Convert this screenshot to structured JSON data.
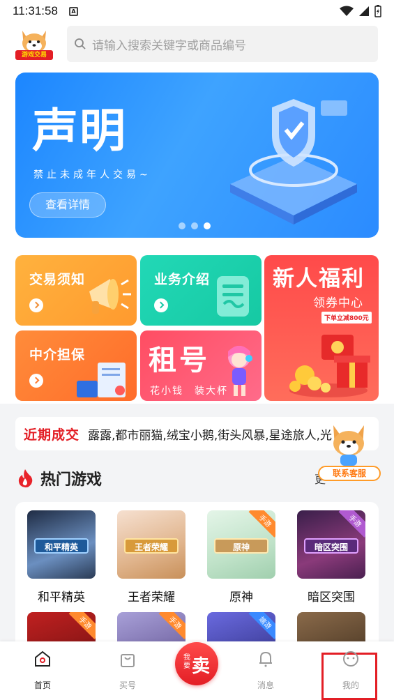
{
  "status_bar": {
    "time": "11:31:58"
  },
  "header": {
    "logo_text": "游戏交易",
    "search_placeholder": "请输入搜索关键字或商品编号"
  },
  "banner": {
    "title": "声明",
    "subtitle": "禁止未成年人交易~",
    "button": "查看详情",
    "dots": 3,
    "active_dot": 3
  },
  "cards": {
    "notice": "交易须知",
    "business": "业务介绍",
    "escrow": "中介担保",
    "rent_big": "租号",
    "rent_small": "花小钱　装大杯",
    "welfare_big": "新人福利",
    "welfare_mid": "领券中心",
    "welfare_tag": "下单立减800元"
  },
  "recent": {
    "label_a": "近期",
    "label_b": "成交",
    "names": "露露,都市丽猫,绒宝小鹅,街头风暴,星途旅人,光"
  },
  "hot": {
    "title": "热门游戏",
    "more": "更",
    "games": [
      {
        "name": "和平精英",
        "logo": "和平精英",
        "badge": "",
        "color1": "#2a3a5a",
        "color2": "#6aa0d8"
      },
      {
        "name": "王者荣耀",
        "logo": "王者荣耀",
        "badge": "",
        "color1": "#f3d6c4",
        "color2": "#c98a5a"
      },
      {
        "name": "原神",
        "logo": "原神",
        "badge": "手游",
        "color1": "#d8efe0",
        "color2": "#a8d4b0"
      },
      {
        "name": "暗区突围",
        "logo": "暗区突围",
        "badge": "手游",
        "color1": "#4a2a5a",
        "color2": "#a04a90"
      }
    ],
    "row2_badges": [
      "手游",
      "手游",
      "端游",
      ""
    ]
  },
  "service": {
    "label": "联系客服"
  },
  "tabbar": {
    "home": "首页",
    "buy": "买号",
    "sell_small": "我要",
    "sell_big": "卖",
    "message": "消息",
    "mine": "我的"
  },
  "colors": {
    "brand_red": "#e31e25",
    "banner_blue": "#2b8bff"
  }
}
